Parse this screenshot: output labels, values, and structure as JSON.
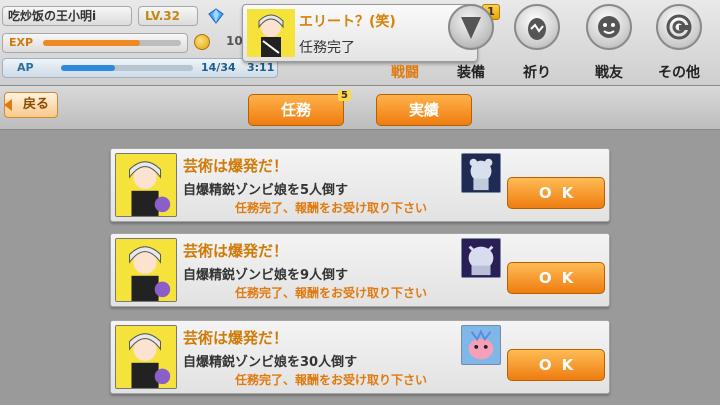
{
  "status": {
    "player_name": "吃炒饭の王小明i",
    "level": "LV.32",
    "exp_label": "EXP",
    "exp_progress": 0.7,
    "coin_value": "10",
    "ap_label": "AP",
    "ap_value": "14/34",
    "ap_progress": 0.41,
    "ap_timer": "3:11"
  },
  "notification": {
    "title": "エリート？(笑)",
    "text": "任務完了",
    "badge": "1"
  },
  "nav": {
    "items": [
      {
        "label": "戦闘",
        "icon": "battle-icon",
        "active": true
      },
      {
        "label": "装備",
        "icon": "equipment-icon",
        "active": false
      },
      {
        "label": "祈り",
        "icon": "prayer-icon",
        "active": false
      },
      {
        "label": "戦友",
        "icon": "friend-icon",
        "active": false
      },
      {
        "label": "その他",
        "icon": "other-icon",
        "active": false
      }
    ]
  },
  "toolbar": {
    "back_label": "戻る",
    "tabs": [
      {
        "label": "任務",
        "badge": "5"
      },
      {
        "label": "実績"
      }
    ]
  },
  "missions": [
    {
      "title": "芸術は爆発だ！",
      "goal": "自爆精鋭ゾンビ娘を5人倒す",
      "reward": "任務完了、報酬をお受け取り下さい",
      "button": "OK",
      "monster": "silver-bear-icon"
    },
    {
      "title": "芸術は爆発だ！",
      "goal": "自爆精鋭ゾンビ娘を9人倒す",
      "reward": "任務完了、報酬をお受け取り下さい",
      "button": "OK",
      "monster": "silver-beast-icon"
    },
    {
      "title": "芸術は爆発だ！",
      "goal": "自爆精鋭ゾンビ娘を30人倒す",
      "reward": "任務完了、報酬をお受け取り下さい",
      "button": "OK",
      "monster": "pink-creature-icon"
    }
  ],
  "colors": {
    "accent": "#ee7d10",
    "title_orange": "#d07a08"
  }
}
